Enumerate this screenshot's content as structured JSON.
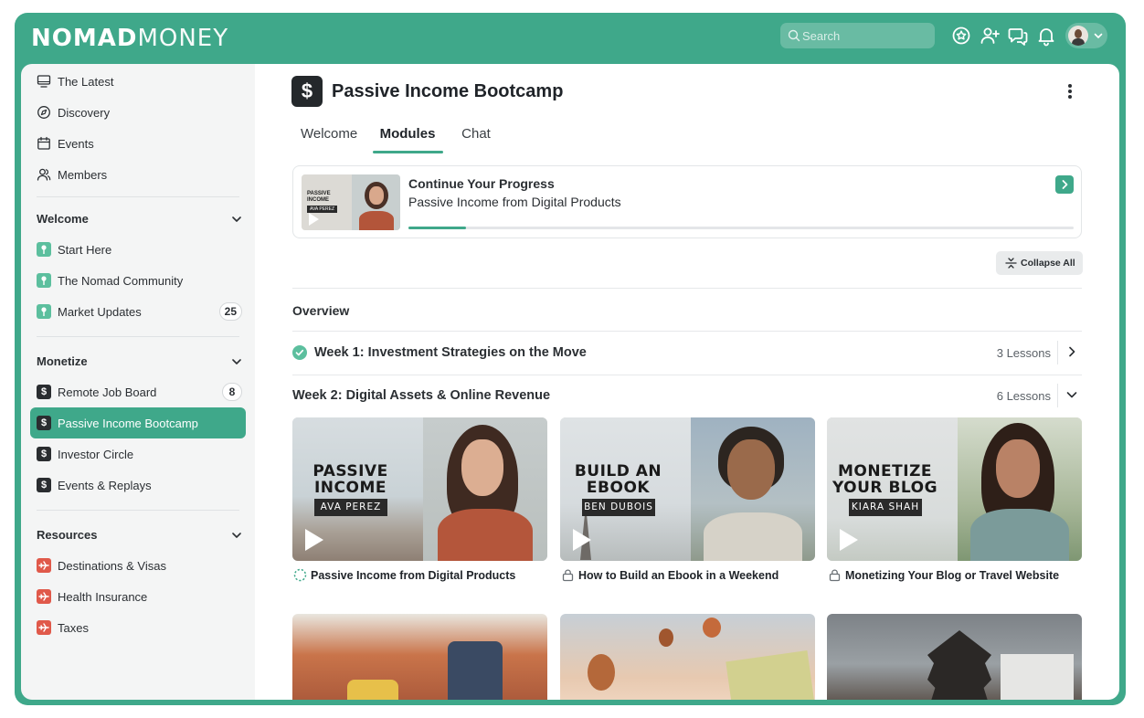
{
  "app": {
    "logo_bold": "NOMAD",
    "logo_light": "MONEY",
    "search_placeholder": "Search",
    "icons": [
      "star-badge-icon",
      "add-user-icon",
      "messages-icon",
      "bell-icon"
    ],
    "brand_color": "#3fa88a"
  },
  "sidebar": {
    "top_items": [
      {
        "label": "The Latest",
        "icon": "monitor-icon"
      },
      {
        "label": "Discovery",
        "icon": "compass-icon"
      },
      {
        "label": "Events",
        "icon": "calendar-icon"
      },
      {
        "label": "Members",
        "icon": "members-icon"
      }
    ],
    "sections": [
      {
        "title": "Welcome",
        "items": [
          {
            "label": "Start Here",
            "icon": "pin-icon"
          },
          {
            "label": "The Nomad Community",
            "icon": "pin-icon"
          },
          {
            "label": "Market Updates",
            "icon": "pin-icon",
            "badge": "25"
          }
        ]
      },
      {
        "title": "Monetize",
        "items": [
          {
            "label": "Remote Job Board",
            "icon": "dollar-icon",
            "badge": "8"
          },
          {
            "label": "Passive Income Bootcamp",
            "icon": "dollar-icon",
            "active": true
          },
          {
            "label": "Investor Circle",
            "icon": "dollar-icon"
          },
          {
            "label": "Events & Replays",
            "icon": "dollar-icon"
          }
        ]
      },
      {
        "title": "Resources",
        "items": [
          {
            "label": "Destinations & Visas",
            "icon": "plane-icon"
          },
          {
            "label": "Health Insurance",
            "icon": "plane-icon"
          },
          {
            "label": "Taxes",
            "icon": "plane-icon"
          }
        ]
      }
    ]
  },
  "main": {
    "title": "Passive Income Bootcamp",
    "tabs": [
      {
        "label": "Welcome"
      },
      {
        "label": "Modules",
        "active": true
      },
      {
        "label": "Chat"
      }
    ],
    "progress": {
      "title": "Continue Your Progress",
      "subtitle": "Passive Income from Digital Products",
      "thumb_text": "PASSIVE INCOME",
      "thumb_name": "AVA PEREZ",
      "fraction": 0.087
    },
    "collapse_label": "Collapse All",
    "overview_label": "Overview",
    "weeks": [
      {
        "label": "Week 1: Investment Strategies on the Move",
        "lessons": "3 Lessons",
        "completed": true,
        "expanded": false
      },
      {
        "label": "Week 2: Digital Assets & Online Revenue",
        "lessons": "6 Lessons",
        "completed": false,
        "expanded": true
      }
    ],
    "lessons": [
      {
        "title": "Passive Income from Digital Products",
        "thumb_line1": "PASSIVE",
        "thumb_line2": "INCOME",
        "thumb_name": "AVA PEREZ",
        "status": "in-progress"
      },
      {
        "title": "How to Build an Ebook in a Weekend",
        "thumb_line1": "BUILD AN",
        "thumb_line2": "EBOOK",
        "thumb_name": "BEN DUBOIS",
        "status": "locked"
      },
      {
        "title": "Monetizing Your Blog or Travel Website",
        "thumb_line1": "MONETIZE",
        "thumb_line2": "YOUR BLOG",
        "thumb_name": "KIARA SHAH",
        "status": "locked"
      }
    ]
  }
}
